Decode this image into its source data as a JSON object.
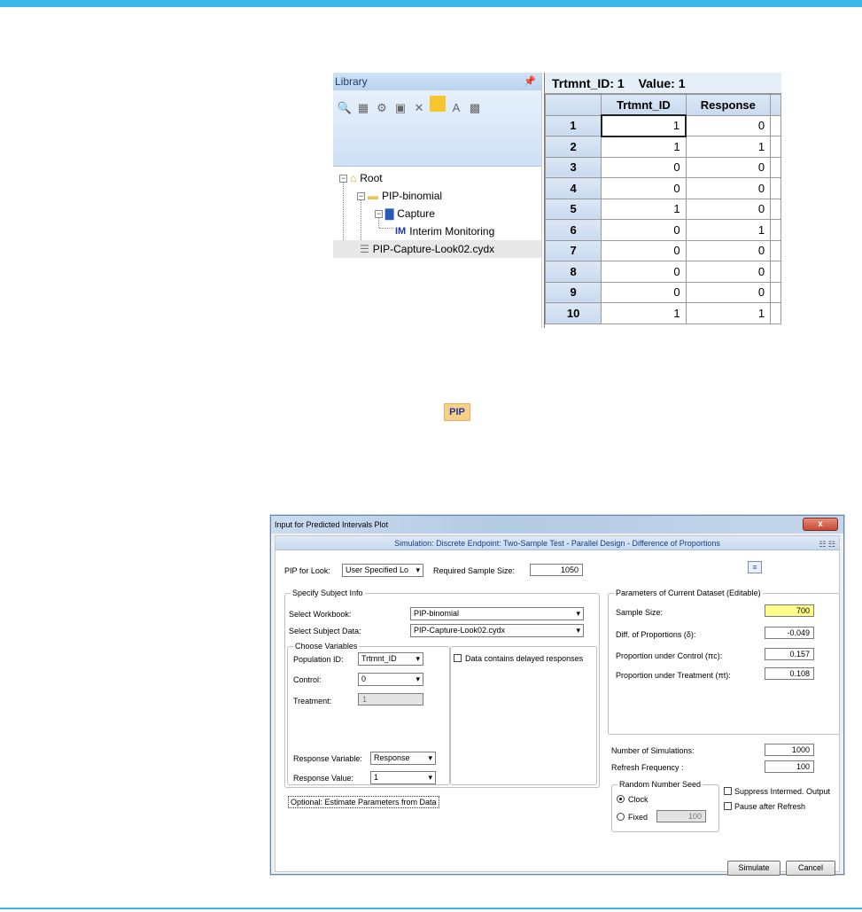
{
  "library": {
    "title": "Library",
    "pin_icon": "pin-icon",
    "tree": [
      {
        "label": "Root",
        "icon": "home-icon"
      },
      {
        "label": "PIP-binomial",
        "icon": "folder-icon"
      },
      {
        "label": "Capture",
        "icon": "design-icon"
      },
      {
        "label": "Interim Monitoring",
        "icon_text": "IM"
      },
      {
        "label": "PIP-Capture-Look02.cydx",
        "icon": "dataset-icon"
      }
    ]
  },
  "grid": {
    "header_field": "Trtmnt_ID: 1",
    "header_value": "Value: 1",
    "columns": [
      "Trtmnt_ID",
      "Response"
    ],
    "rows": [
      {
        "n": "1",
        "t": "1",
        "r": "0"
      },
      {
        "n": "2",
        "t": "1",
        "r": "1"
      },
      {
        "n": "3",
        "t": "0",
        "r": "0"
      },
      {
        "n": "4",
        "t": "0",
        "r": "0"
      },
      {
        "n": "5",
        "t": "1",
        "r": "0"
      },
      {
        "n": "6",
        "t": "0",
        "r": "1"
      },
      {
        "n": "7",
        "t": "0",
        "r": "0"
      },
      {
        "n": "8",
        "t": "0",
        "r": "0"
      },
      {
        "n": "9",
        "t": "0",
        "r": "0"
      },
      {
        "n": "10",
        "t": "1",
        "r": "1"
      }
    ]
  },
  "pip_icon_label": "PIP",
  "dialog": {
    "title": "Input for Predicted Intervals Plot",
    "close_label": "x",
    "subtitle": "Simulation: Discrete Endpoint: Two-Sample Test - Parallel Design - Difference of Proportions",
    "pip_for_look_label": "PIP for Look:",
    "pip_for_look_value": "User Specified Lo",
    "required_sample_size_label": "Required Sample Size:",
    "required_sample_size_value": "1050",
    "subject_info": {
      "title": "Specify Subject Info",
      "workbook_label": "Select Workbook:",
      "workbook_value": "PIP-binomial",
      "subject_data_label": "Select Subject Data:",
      "subject_data_value": "PIP-Capture-Look02.cydx"
    },
    "choose_variables": {
      "title": "Choose Variables",
      "population_id_label": "Population ID:",
      "population_id_value": "Trtmnt_ID",
      "control_label": "Control:",
      "control_value": "0",
      "treatment_label": "Treatment:",
      "treatment_value": "1",
      "response_variable_label": "Response Variable:",
      "response_variable_value": "Response",
      "response_value_label": "Response Value:",
      "response_value_value": "1"
    },
    "delayed_label": "Data contains delayed responses",
    "estimate_button": "Optional: Estimate Parameters from Data",
    "params": {
      "title": "Parameters of Current Dataset (Editable)",
      "sample_size_label": "Sample Size:",
      "sample_size_value": "700",
      "diff_label": "Diff. of Proportions (δ):",
      "diff_value": "-0.049",
      "control_label": "Proportion under Control (πc):",
      "control_value": "0.157",
      "treatment_label": "Proportion under Treatment (πt):",
      "treatment_value": "0.108"
    },
    "num_sims_label": "Number of Simulations:",
    "num_sims_value": "1000",
    "refresh_label": "Refresh Frequency :",
    "refresh_value": "100",
    "seed": {
      "title": "Random Number Seed",
      "clock_label": "Clock",
      "fixed_label": "Fixed",
      "fixed_value": "100"
    },
    "suppress_label": "Suppress Intermed. Output",
    "pause_label": "Pause after Refresh",
    "simulate_button": "Simulate",
    "cancel_button": "Cancel"
  }
}
